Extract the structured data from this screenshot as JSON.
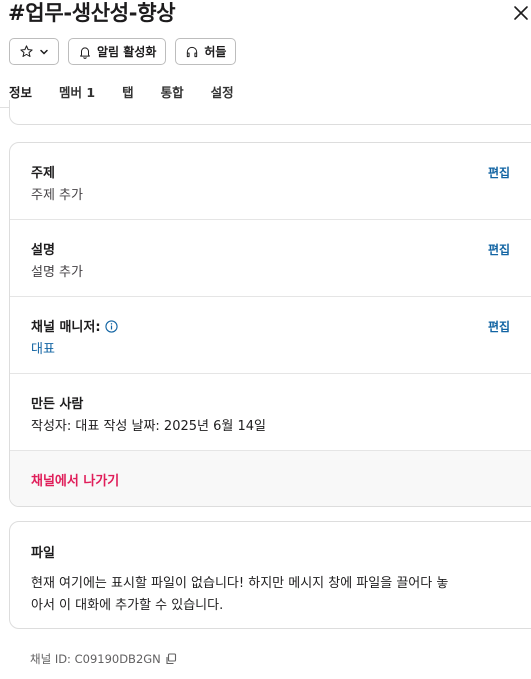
{
  "header": {
    "title": "#업무-생산성-향상"
  },
  "toolbar": {
    "notifications_label": "알림 활성화",
    "huddle_label": "허들"
  },
  "tabs": [
    {
      "label": "정보",
      "active": true
    },
    {
      "label": "멤버 1"
    },
    {
      "label": "탭"
    },
    {
      "label": "통합"
    },
    {
      "label": "설정"
    }
  ],
  "about": {
    "topic": {
      "title": "주제",
      "value": "주제 추가",
      "edit": "편집"
    },
    "description": {
      "title": "설명",
      "value": "설명 추가",
      "edit": "편집"
    },
    "managers": {
      "title": "채널 매니저:",
      "value": "대표",
      "edit": "편집"
    },
    "created": {
      "title": "만든 사람",
      "value": "작성자: 대표 작성 날짜: 2025년 6월 14일"
    },
    "leave": "채널에서 나가기"
  },
  "files": {
    "title": "파일",
    "message_line1": "현재 여기에는 표시할 파일이 없습니다! 하지만 메시지 창에 파일을 끌어다 놓",
    "message_line2": "아서 이 대화에 추가할 수 있습니다."
  },
  "footer": {
    "channel_id": "채널 ID: C09190DB2GN"
  },
  "colors": {
    "link": "#1264a3",
    "danger": "#e01e5a",
    "tab_indicator": "#611f69"
  }
}
